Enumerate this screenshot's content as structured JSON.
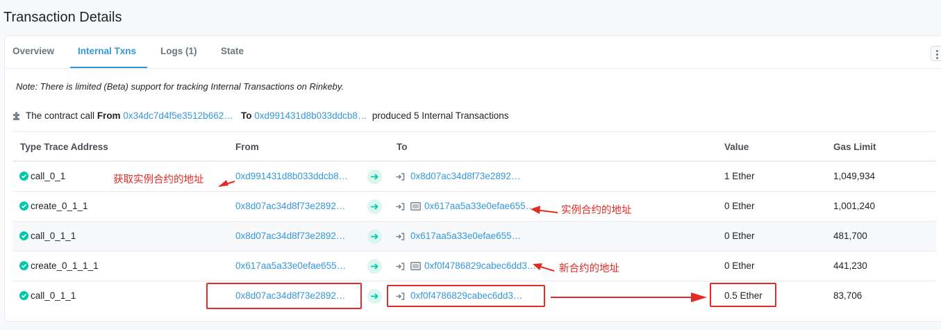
{
  "page": {
    "title": "Transaction Details"
  },
  "tabs": [
    {
      "label": "Overview"
    },
    {
      "label": "Internal Txns"
    },
    {
      "label": "Logs (1)"
    },
    {
      "label": "State"
    }
  ],
  "note": "Note: There is limited (Beta) support for tracking Internal Transactions on Rinkeby.",
  "summary": {
    "prefix": "The contract call",
    "from_label": "From",
    "from_address": "0x34dc7d4f5e3512b662…",
    "to_label": "To",
    "to_address": "0xd991431d8b033ddcb8…",
    "suffix": "produced 5 Internal Transactions"
  },
  "table": {
    "headers": [
      "Type Trace Address",
      "From",
      "To",
      "Value",
      "Gas Limit"
    ],
    "rows": [
      {
        "type": "call_0_1",
        "from": "0xd991431d8b033ddcb8…",
        "to": "0x8d07ac34d8f73e2892…",
        "value": "1 Ether",
        "gas": "1,049,934"
      },
      {
        "type": "create_0_1_1",
        "from": "0x8d07ac34d8f73e2892…",
        "to": "0x617aa5a33e0efae655…",
        "value": "0 Ether",
        "gas": "1,001,240"
      },
      {
        "type": "call_0_1_1",
        "from": "0x8d07ac34d8f73e2892…",
        "to": "0x617aa5a33e0efae655…",
        "value": "0 Ether",
        "gas": "481,700"
      },
      {
        "type": "create_0_1_1_1",
        "from": "0x617aa5a33e0efae655…",
        "to": "0xf0f4786829cabec6dd3…",
        "value": "0 Ether",
        "gas": "441,230"
      },
      {
        "type": "call_0_1_1",
        "from": "0x8d07ac34d8f73e2892…",
        "to": "0xf0f4786829cabec6dd3…",
        "value": "0.5 Ether",
        "gas": "83,706"
      }
    ]
  },
  "annotations": {
    "get_instance": "获取实例合约的地址",
    "instance_address": "实例合约的地址",
    "new_contract_address": "新合约的地址"
  },
  "colors": {
    "accent": "#3498db",
    "success": "#00c9a7",
    "annotation": "#e22b24"
  },
  "icons": {
    "summary": "puzzle-icon",
    "status": "check-circle-icon",
    "transfer": "arrow-right-icon",
    "to_prefix": "sign-in-icon",
    "contract": "contract-icon",
    "menu": "kebab-icon"
  }
}
